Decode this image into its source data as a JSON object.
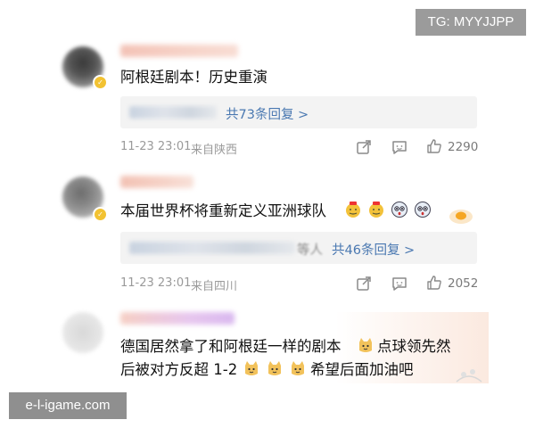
{
  "watermark_top": "TG: MYYJJPP",
  "watermark_bottom": "e-l-igame.com",
  "comments": [
    {
      "text": "阿根廷剧本！历史重演",
      "reply_summary": "共73条回复 >",
      "time": "11-23 23:01",
      "location": "来自陕西",
      "likes": "2290"
    },
    {
      "text": "本届世界杯将重新定义亚洲球队",
      "reply_tail": "等人",
      "reply_summary": "共46条回复 >",
      "time": "11-23 23:01",
      "location": "来自四川",
      "likes": "2052"
    },
    {
      "text_line1": "德国居然拿了和阿根廷一样的剧本",
      "text_line1b": "点球领先然",
      "text_line2": "后被对方反超 1-2",
      "text_line2b": "希望后面加油吧"
    }
  ],
  "icons": {
    "share": "share-icon",
    "comment": "comment-icon",
    "like": "thumbs-up-icon",
    "badge": "verified-badge-icon"
  },
  "colors": {
    "link_blue": "#4a78b1",
    "meta_gray": "#9a9a9a",
    "reply_bg": "#f3f3f3",
    "badge_gold": "#f2c232"
  }
}
